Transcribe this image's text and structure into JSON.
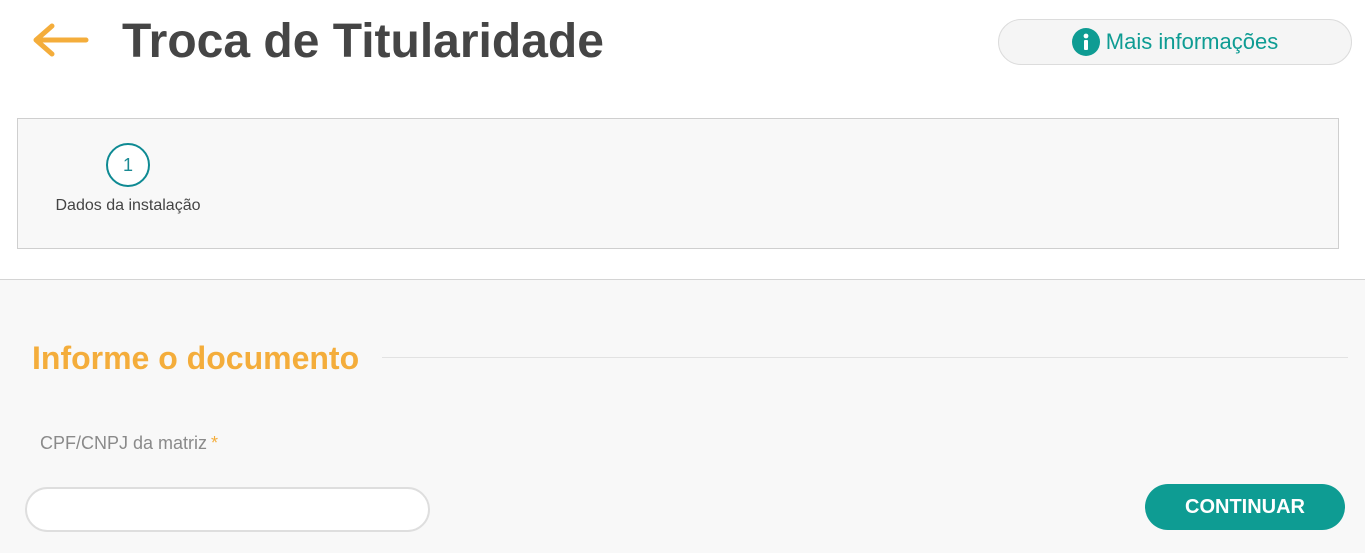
{
  "header": {
    "back_icon": "arrow-left-icon",
    "title": "Troca de Titularidade",
    "info_button": {
      "icon": "info-circle-icon",
      "label": "Mais informações"
    }
  },
  "stepper": {
    "steps": [
      {
        "number": "1",
        "label": "Dados da instalação"
      }
    ]
  },
  "form": {
    "section_title": "Informe o documento",
    "field_label": "CPF/CNPJ da matriz",
    "required_mark": "*",
    "input_value": "",
    "continue_label": "CONTINUAR"
  },
  "colors": {
    "accent_orange": "#f4ad3b",
    "accent_teal": "#0e9c93",
    "title_gray": "#454545"
  }
}
